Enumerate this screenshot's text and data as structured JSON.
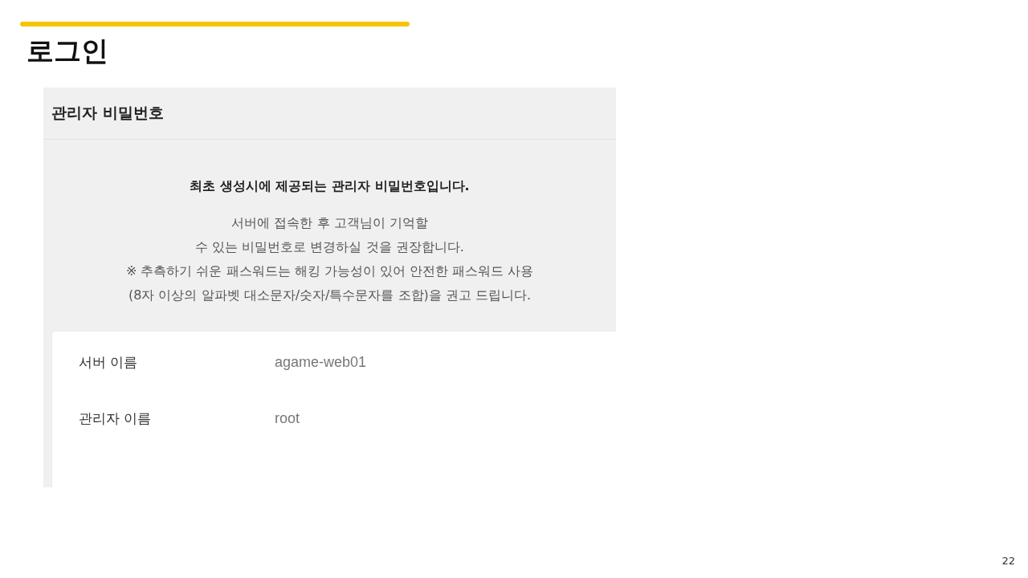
{
  "slide": {
    "title": "로그인",
    "page_number": "22"
  },
  "panel": {
    "title": "관리자 비밀번호",
    "heading": "최초 생성시에 제공되는 관리자 비밀번호입니다.",
    "lines": [
      "서버에 접속한 후 고객님이 기억할",
      "수 있는 비밀번호로 변경하실 것을 권장합니다.",
      "※ 추측하기 쉬운 패스워드는 해킹 가능성이 있어 안전한 패스워드 사용",
      "(8자 이상의 알파벳 대소문자/숫자/특수문자를 조합)을 권고 드립니다."
    ],
    "fields": [
      {
        "label": "서버 이름",
        "value": "agame-web01"
      },
      {
        "label": "관리자 이름",
        "value": "root"
      }
    ]
  }
}
